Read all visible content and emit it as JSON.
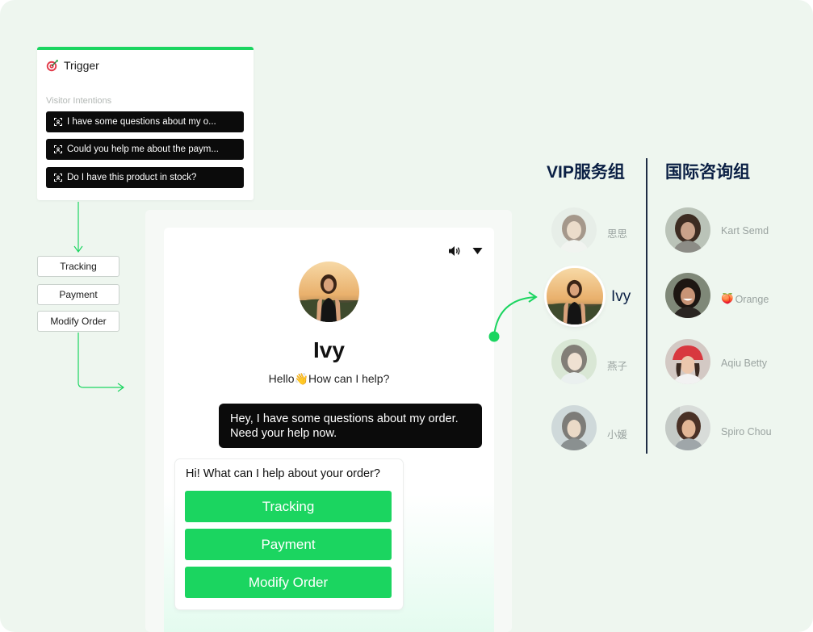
{
  "trigger": {
    "title": "Trigger",
    "subtitle": "Visitor Intentions",
    "intents": [
      "I have some questions about my o...",
      "Could you help me about the paym...",
      "Do I have this product in stock?"
    ]
  },
  "flow_options": [
    "Tracking",
    "Payment",
    "Modify Order"
  ],
  "chat": {
    "agent_name": "Ivy",
    "greeting": "Hello👋How can I help?",
    "user_message": "Hey, I have some questions about my order. Need your help now.",
    "bot_question": "Hi! What can I help about your order?",
    "options": [
      "Tracking",
      "Payment",
      "Modify Order"
    ]
  },
  "groups": [
    {
      "title": "VIP服务组",
      "agents": [
        {
          "name": "思思"
        },
        {
          "name": "Ivy",
          "active": true
        },
        {
          "name": "燕子"
        },
        {
          "name": "小媛"
        }
      ]
    },
    {
      "title": "国际咨询组",
      "agents": [
        {
          "name": "Kart Semd"
        },
        {
          "name": "Orange",
          "emoji": "🍑"
        },
        {
          "name": "Aqiu Betty"
        },
        {
          "name": "Spiro Chou"
        }
      ]
    }
  ],
  "colors": {
    "accent": "#1bd560",
    "background": "#eef6ef",
    "dark": "#0b0b0b",
    "navy": "#0a1f44"
  }
}
